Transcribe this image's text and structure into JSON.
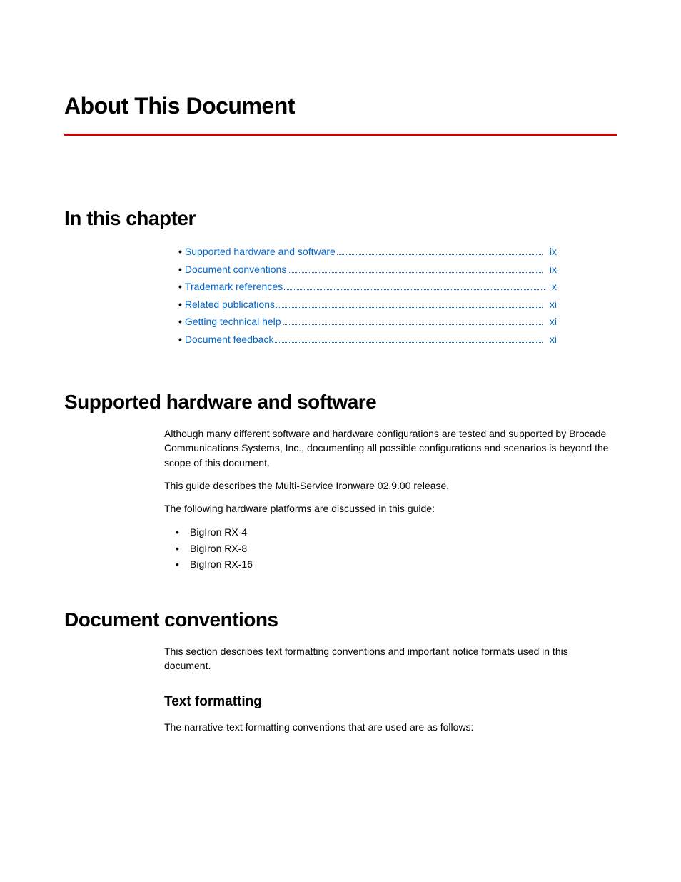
{
  "title": "About This Document",
  "sections": {
    "inThisChapter": {
      "heading": "In this chapter",
      "toc": [
        {
          "label": "Supported hardware and software",
          "page": "ix"
        },
        {
          "label": "Document conventions",
          "page": "ix"
        },
        {
          "label": "Trademark references",
          "page": "x"
        },
        {
          "label": "Related publications",
          "page": "xi"
        },
        {
          "label": "Getting technical help",
          "page": "xi"
        },
        {
          "label": "Document feedback",
          "page": "xi"
        }
      ]
    },
    "supported": {
      "heading": "Supported hardware and software",
      "para1": "Although many different software and hardware configurations are tested and supported by Brocade Communications Systems, Inc., documenting all possible configurations and scenarios is beyond the scope of this document.",
      "para2": "This guide describes the Multi-Service Ironware 02.9.00 release.",
      "para3": "The following hardware platforms are discussed in this guide:",
      "bullets": [
        "BigIron RX-4",
        "BigIron RX-8",
        "BigIron RX-16"
      ]
    },
    "conventions": {
      "heading": "Document conventions",
      "para1": "This section describes text formatting conventions and important notice formats used in this document.",
      "sub": {
        "heading": "Text formatting",
        "para1": "The narrative-text formatting conventions that are used are as follows:"
      }
    }
  }
}
